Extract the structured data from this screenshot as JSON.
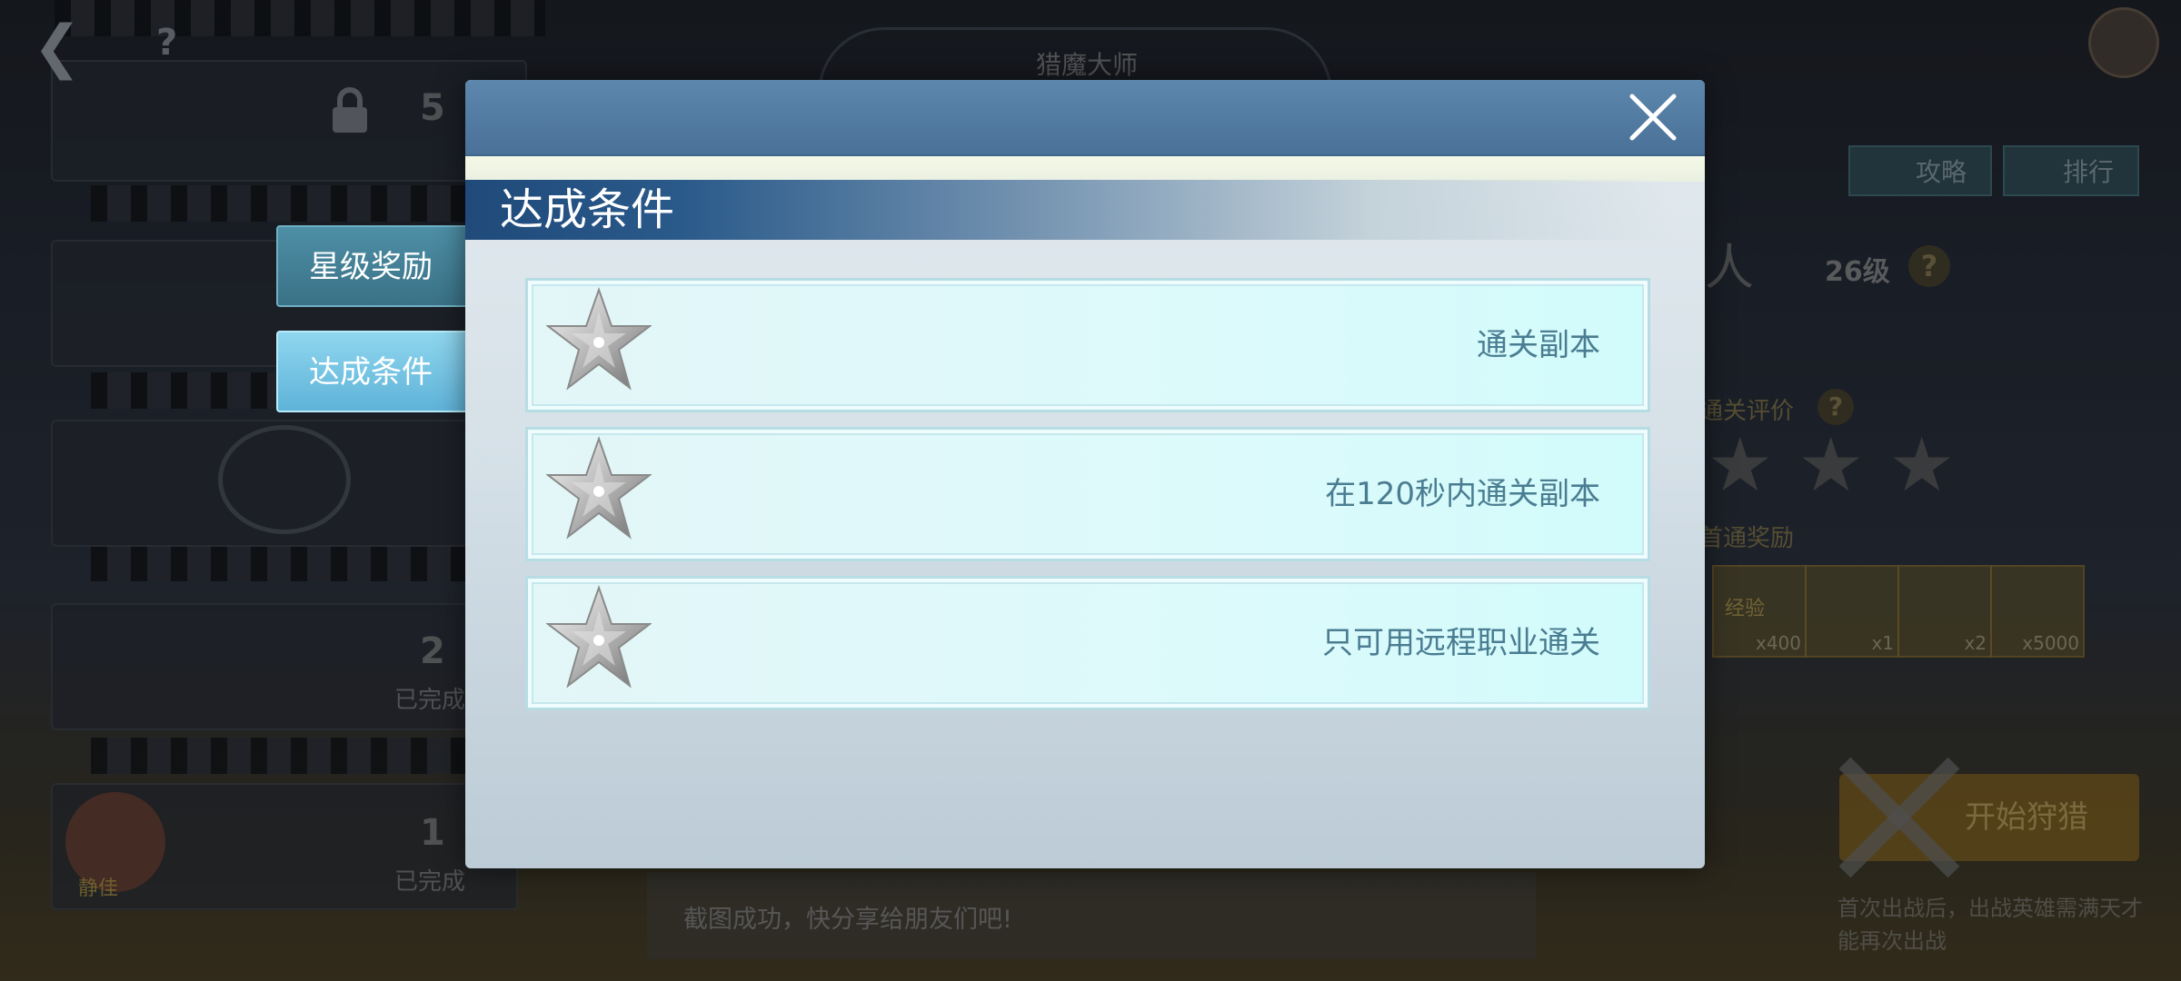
{
  "background": {
    "header_title": "猎魔大师",
    "tabs": [
      {
        "label": "攻略"
      },
      {
        "label": "排行"
      }
    ],
    "boss_name_partial": "人",
    "level": "26级",
    "evaluation_label": "通关评价",
    "first_clear_reward_label": "首通奖励",
    "stage_numbers": [
      "5",
      "2",
      "1"
    ],
    "completed_labels": [
      "已完成",
      "已完成"
    ],
    "item_counts": [
      "x400",
      "x1",
      "x2",
      "x5000"
    ],
    "item_label": "经验",
    "start_button": "开始狩猎",
    "share_text": "截图成功，快分享给朋友们吧!",
    "footnote": "首次出战后，出战英雄需满天才能再次出战",
    "avatar_name": "静佳"
  },
  "side_tabs": [
    {
      "label": "星级奖励",
      "active": false
    },
    {
      "label": "达成条件",
      "active": true
    }
  ],
  "modal": {
    "section_title": "达成条件",
    "close_icon": "close-icon",
    "conditions": [
      {
        "text": "通关副本",
        "icon": "silver-star-icon"
      },
      {
        "text": "在120秒内通关副本",
        "icon": "silver-star-icon"
      },
      {
        "text": "只可用远程职业通关",
        "icon": "silver-star-icon"
      }
    ]
  },
  "colors": {
    "header_blue": "#5d87ad",
    "banner_blue": "#1f4a7a",
    "row_bg": "#ddfafb",
    "row_text": "#4a7d92",
    "active_tab": "#8fd6ef",
    "inactive_tab": "#4d8fa6"
  }
}
